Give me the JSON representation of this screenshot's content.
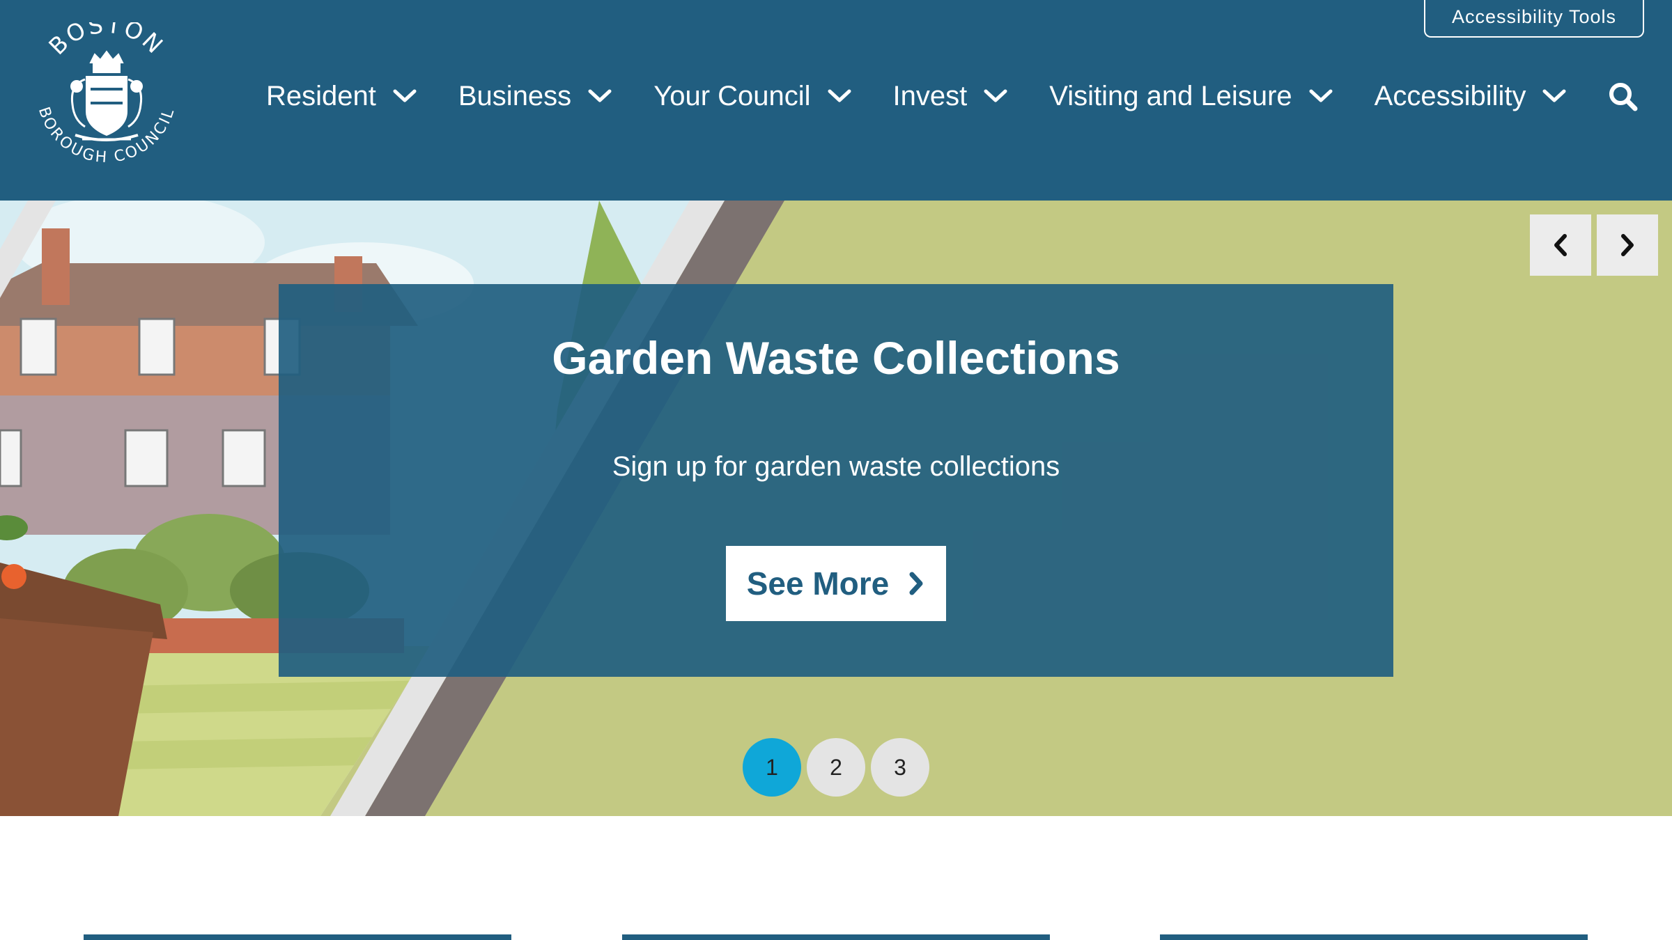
{
  "header": {
    "logo": {
      "top_text": "BOSTON",
      "bottom_text": "BOROUGH COUNCIL",
      "icon": "coat-of-arms"
    },
    "accessibility_tools_label": "Accessibility Tools",
    "nav": [
      {
        "label": "Resident",
        "icon": "chevron-down-icon"
      },
      {
        "label": "Business",
        "icon": "chevron-down-icon"
      },
      {
        "label": "Your Council",
        "icon": "chevron-down-icon"
      },
      {
        "label": "Invest",
        "icon": "chevron-down-icon"
      },
      {
        "label": "Visiting and Leisure",
        "icon": "chevron-down-icon"
      },
      {
        "label": "Accessibility",
        "icon": "chevron-down-icon"
      }
    ],
    "search_icon": "search-icon"
  },
  "hero": {
    "title": "Garden Waste Collections",
    "subtitle": "Sign up for garden waste collections",
    "cta_label": "See More",
    "cta_icon": "chevron-right-icon",
    "prev_icon": "chevron-left-icon",
    "next_icon": "chevron-right-icon",
    "pages": [
      "1",
      "2",
      "3"
    ],
    "active_page": "1"
  },
  "colors": {
    "brand": "#215e80",
    "hero_bg": "#c3c983",
    "active_dot": "#0fa7d8",
    "inactive_dot": "#e4e4e4"
  }
}
